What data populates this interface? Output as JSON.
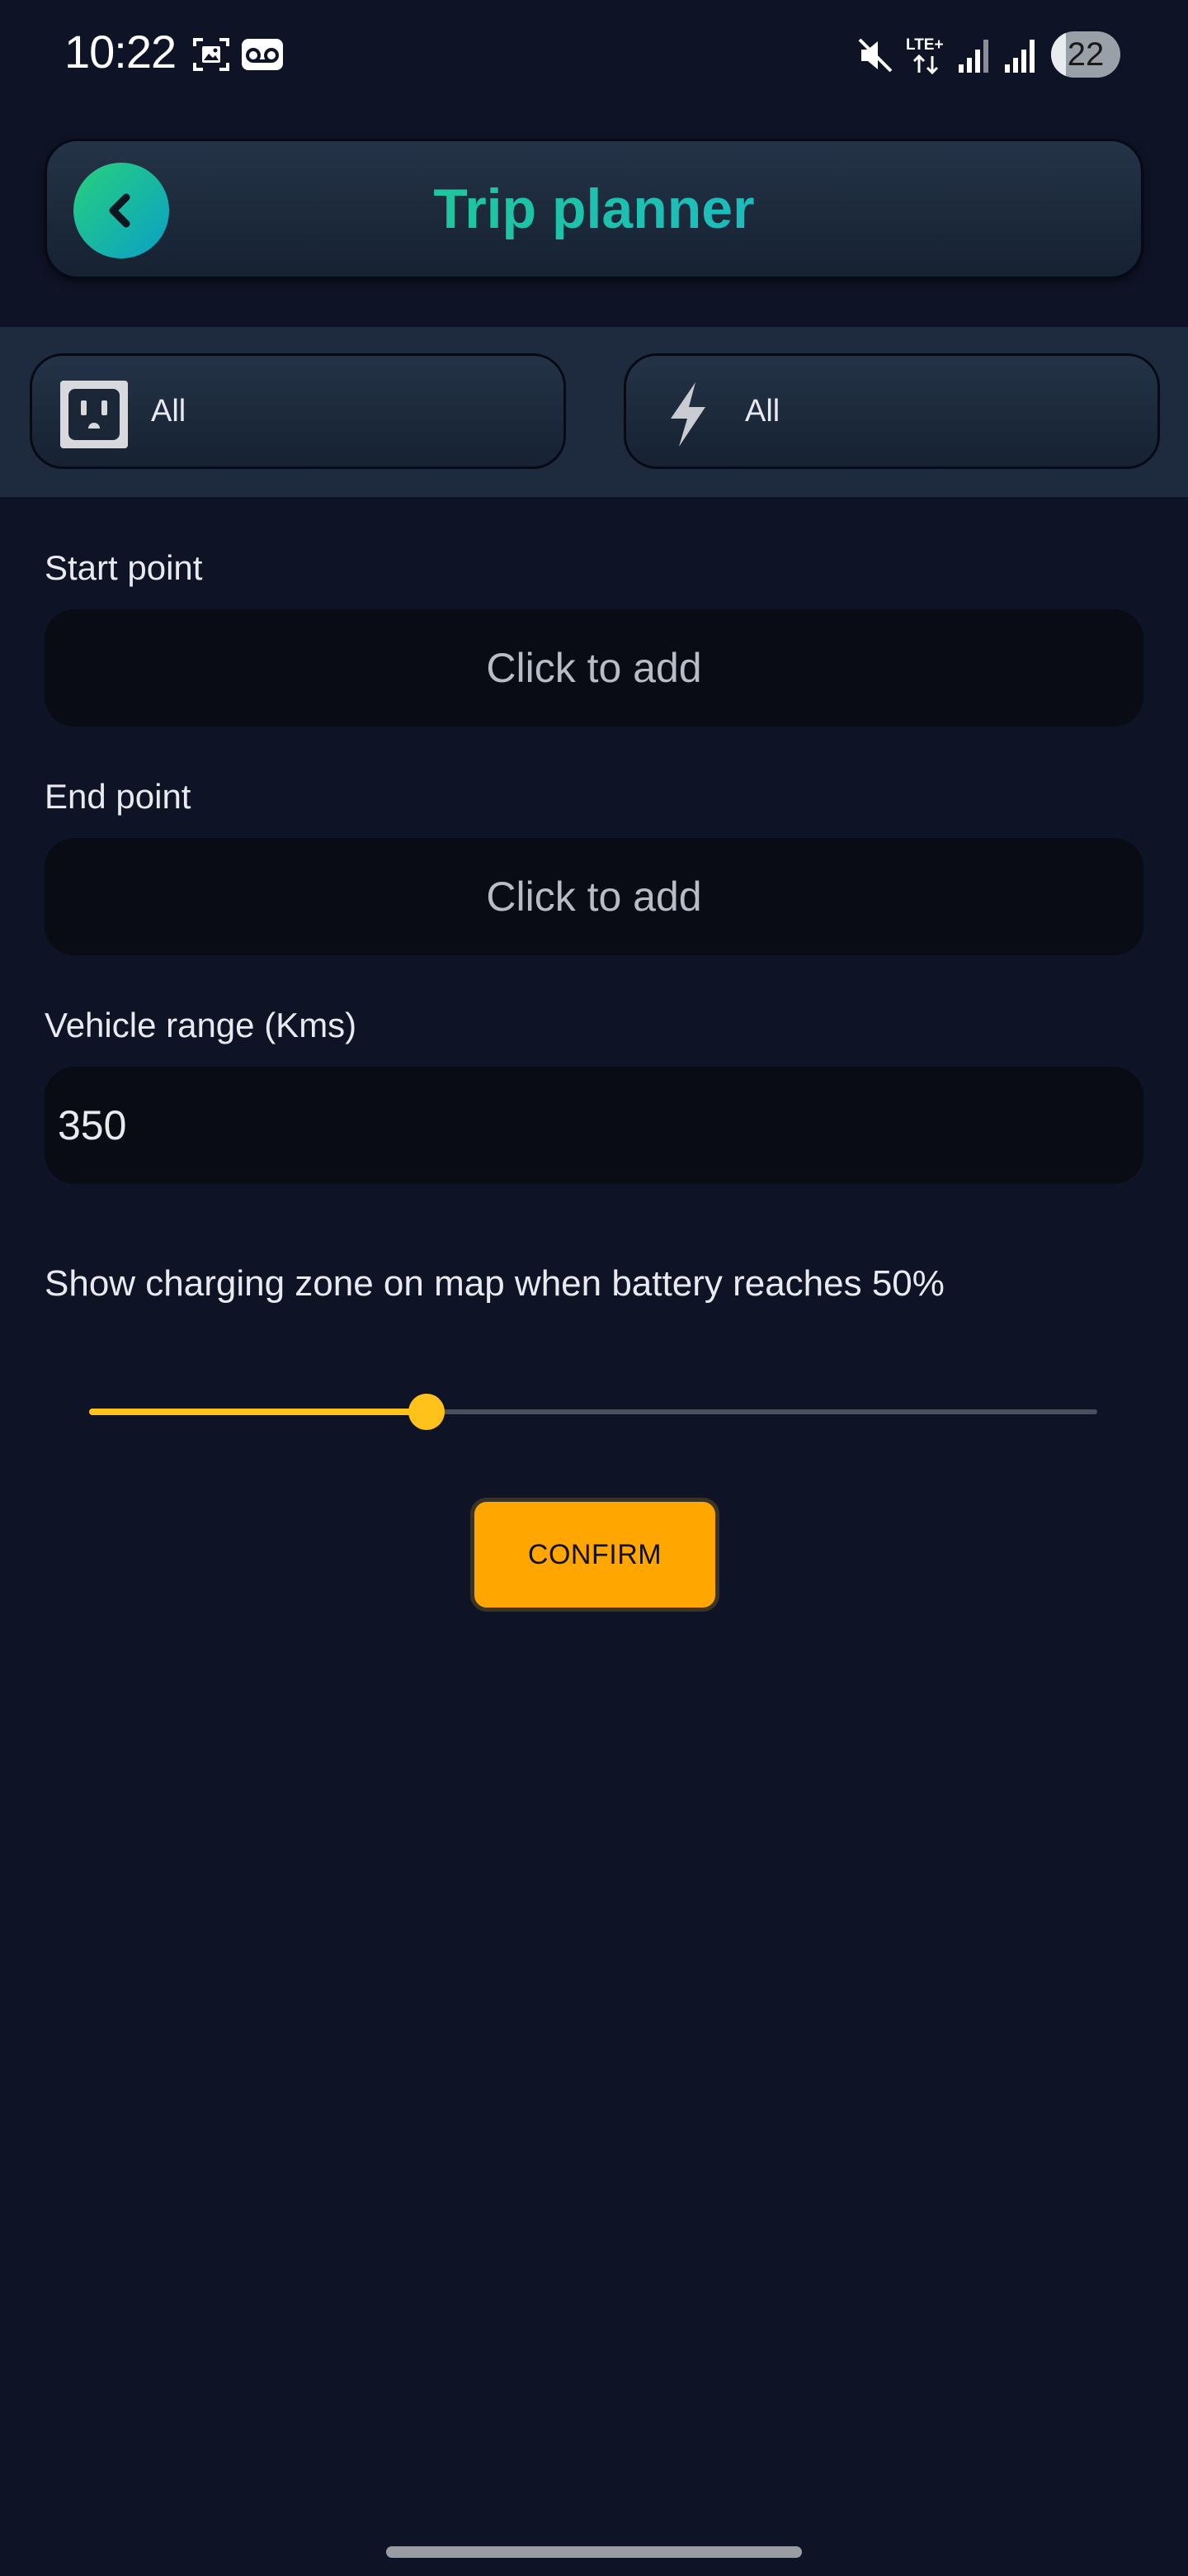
{
  "status_bar": {
    "time": "10:22",
    "network": "LTE+",
    "battery_level": "22",
    "battery_fraction": 0.22,
    "icons": [
      "screenshot-icon",
      "voicemail-icon",
      "mute-icon",
      "lte-icon",
      "signal-icon",
      "signal-icon",
      "battery-icon"
    ]
  },
  "header": {
    "title": "Trip planner",
    "back_icon": "chevron-left-icon"
  },
  "filters": {
    "connector": {
      "icon": "power-outlet-icon",
      "label": "All"
    },
    "power": {
      "icon": "lightning-icon",
      "label": "All"
    }
  },
  "form": {
    "start_point": {
      "label": "Start point",
      "placeholder": "Click to add"
    },
    "end_point": {
      "label": "End point",
      "placeholder": "Click to add"
    },
    "vehicle_range": {
      "label": "Vehicle range (Kms)",
      "value": "350"
    }
  },
  "slider": {
    "caption": "Show charging zone on map when battery reaches 50%",
    "value_percent": 50,
    "position_fraction": 0.335
  },
  "confirm_label": "CONFIRM",
  "colors": {
    "background": "#0f1326",
    "accent_yellow": "#ffc21a",
    "confirm": "#ffa600",
    "title_gradient": [
      "#22d27a",
      "#19b0e0"
    ]
  }
}
